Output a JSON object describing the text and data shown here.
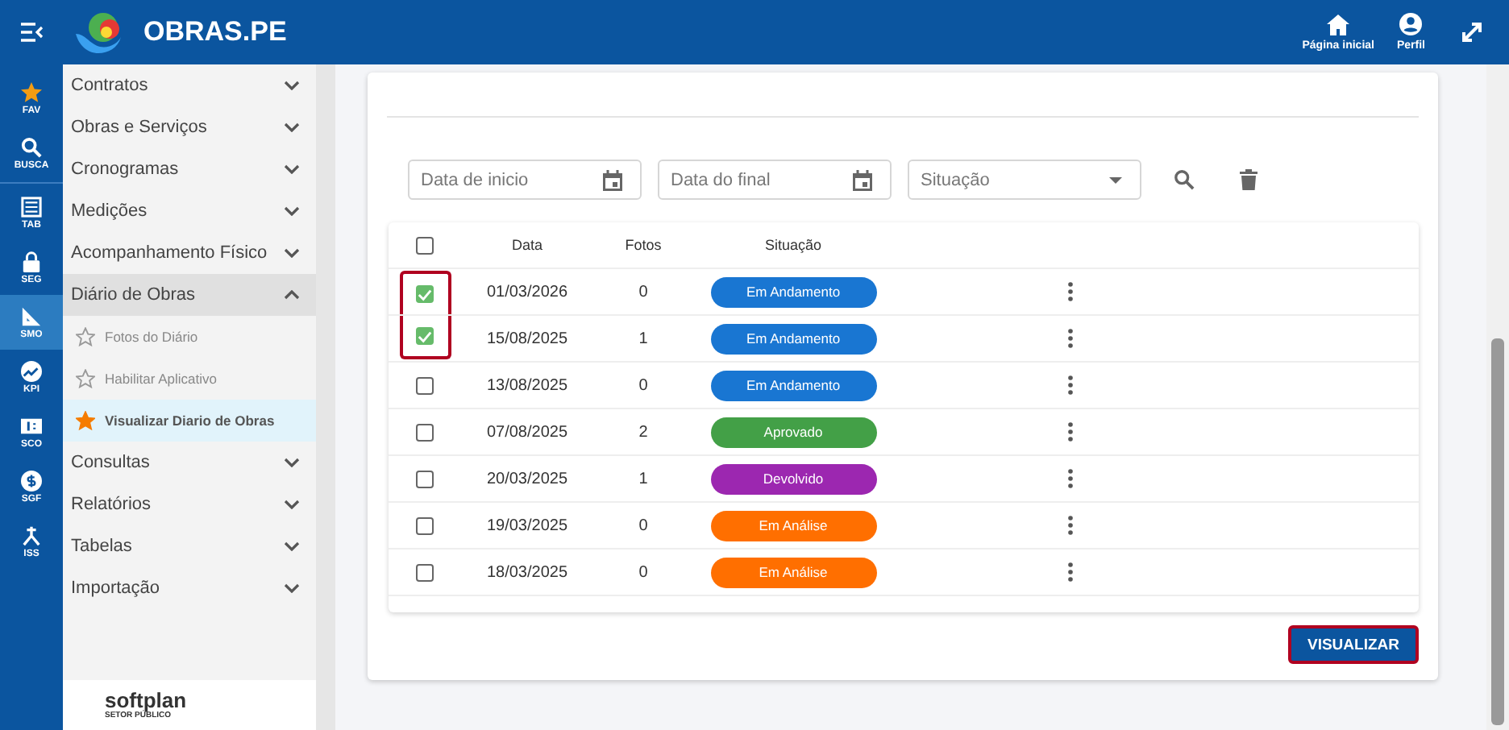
{
  "header": {
    "app_name": "OBRAS.PE",
    "actions": [
      {
        "kind": "home",
        "label": "Página inicial"
      },
      {
        "kind": "profile",
        "label": "Perfil"
      }
    ]
  },
  "rail": [
    {
      "kind": "star",
      "label": "FAV",
      "selected": false
    },
    {
      "kind": "search",
      "label": "BUSCA",
      "selected": false
    },
    {
      "kind": "table",
      "label": "TAB",
      "selected": false
    },
    {
      "kind": "lock",
      "label": "SEG",
      "selected": false
    },
    {
      "kind": "ruler",
      "label": "SMO",
      "selected": true
    },
    {
      "kind": "chart",
      "label": "KPI",
      "selected": false
    },
    {
      "kind": "money",
      "label": "SCO",
      "selected": false
    },
    {
      "kind": "coin",
      "label": "SGF",
      "selected": false
    },
    {
      "kind": "split",
      "label": "ISS",
      "selected": false
    }
  ],
  "sidebar": {
    "items": [
      {
        "label": "Contratos",
        "expanded": false
      },
      {
        "label": "Obras e Serviços",
        "expanded": false
      },
      {
        "label": "Cronogramas",
        "expanded": false
      },
      {
        "label": "Medições",
        "expanded": false
      },
      {
        "label": "Acompanhamento Físico",
        "expanded": false
      },
      {
        "label": "Diário de Obras",
        "expanded": true,
        "children": [
          {
            "label": "Fotos do Diário",
            "favorite": false,
            "selected": false
          },
          {
            "label": "Habilitar Aplicativo",
            "favorite": false,
            "selected": false
          },
          {
            "label": "Visualizar Diario de Obras",
            "favorite": true,
            "selected": true
          }
        ]
      },
      {
        "label": "Consultas",
        "expanded": false
      },
      {
        "label": "Relatórios",
        "expanded": false
      },
      {
        "label": "Tabelas",
        "expanded": false
      },
      {
        "label": "Importação",
        "expanded": false
      }
    ],
    "footer": {
      "brand": "softplan",
      "tagline": "SETOR PÚBLICO"
    }
  },
  "filters": [
    {
      "kind": "date",
      "placeholder": "Data de inicio"
    },
    {
      "kind": "date",
      "placeholder": "Data do final"
    },
    {
      "kind": "select",
      "placeholder": "Situação"
    }
  ],
  "table": {
    "select_all": false,
    "columns": [
      "Data",
      "Fotos",
      "Situação"
    ],
    "rows": [
      {
        "checked": true,
        "highlighted": true,
        "date": "01/03/2026",
        "photos": "0",
        "status": "Em Andamento",
        "color": "#1976d2"
      },
      {
        "checked": true,
        "highlighted": true,
        "date": "15/08/2025",
        "photos": "1",
        "status": "Em Andamento",
        "color": "#1976d2"
      },
      {
        "checked": false,
        "highlighted": false,
        "date": "13/08/2025",
        "photos": "0",
        "status": "Em Andamento",
        "color": "#1976d2"
      },
      {
        "checked": false,
        "highlighted": false,
        "date": "07/08/2025",
        "photos": "2",
        "status": "Aprovado",
        "color": "#43a047"
      },
      {
        "checked": false,
        "highlighted": false,
        "date": "20/03/2025",
        "photos": "1",
        "status": "Devolvido",
        "color": "#9c27b0"
      },
      {
        "checked": false,
        "highlighted": false,
        "date": "19/03/2025",
        "photos": "0",
        "status": "Em Análise",
        "color": "#ff6f00"
      },
      {
        "checked": false,
        "highlighted": false,
        "date": "18/03/2025",
        "photos": "0",
        "status": "Em Análise",
        "color": "#ff6f00"
      }
    ]
  },
  "view_button": {
    "label": "VISUALIZAR",
    "highlighted": true
  }
}
